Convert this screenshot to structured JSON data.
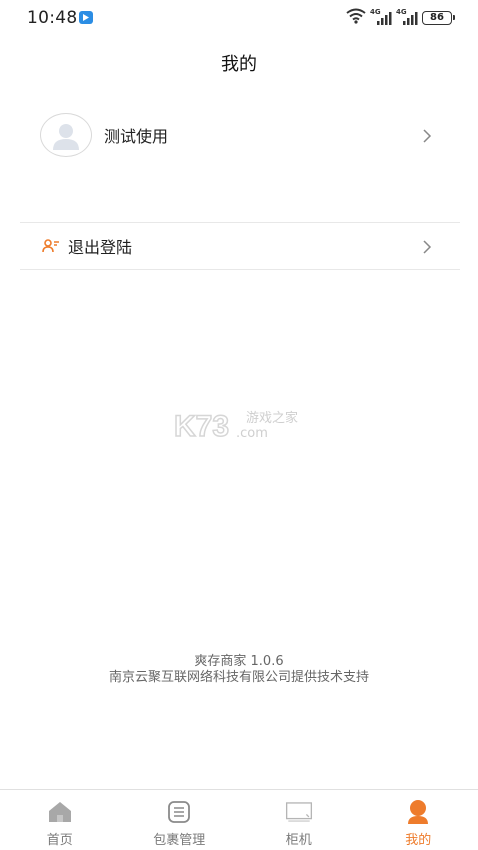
{
  "status_bar": {
    "time": "10:48",
    "network_1": "4G",
    "network_2": "4G",
    "battery": "86",
    "icons": [
      "app-notification-icon",
      "wifi-icon",
      "signal-icon",
      "signal-icon",
      "battery-icon"
    ]
  },
  "header": {
    "title": "我的"
  },
  "profile": {
    "name": "测试使用",
    "avatar_icon": "default-avatar-icon"
  },
  "menu": {
    "logout_label": "退出登陆",
    "logout_icon": "user-logout-icon"
  },
  "watermark": {
    "brand": "K73",
    "site_cn": "游戏之家",
    "site_en": ".com"
  },
  "footer": {
    "app_version": "爽存商家 1.0.6",
    "support_text": "南京云聚互联网络科技有限公司提供技术支持"
  },
  "tab_bar": {
    "tabs": [
      {
        "label": "首页",
        "icon": "home-icon"
      },
      {
        "label": "包裹管理",
        "icon": "package-list-icon"
      },
      {
        "label": "柜机",
        "icon": "cabinet-monitor-icon"
      },
      {
        "label": "我的",
        "icon": "profile-icon"
      }
    ],
    "active": "我的"
  },
  "colors": {
    "accent": "#EE7C2C",
    "inactive_icon": "#A8A8A8",
    "divider": "#E8E8E8",
    "text_primary": "#222222",
    "text_secondary": "#666666"
  }
}
